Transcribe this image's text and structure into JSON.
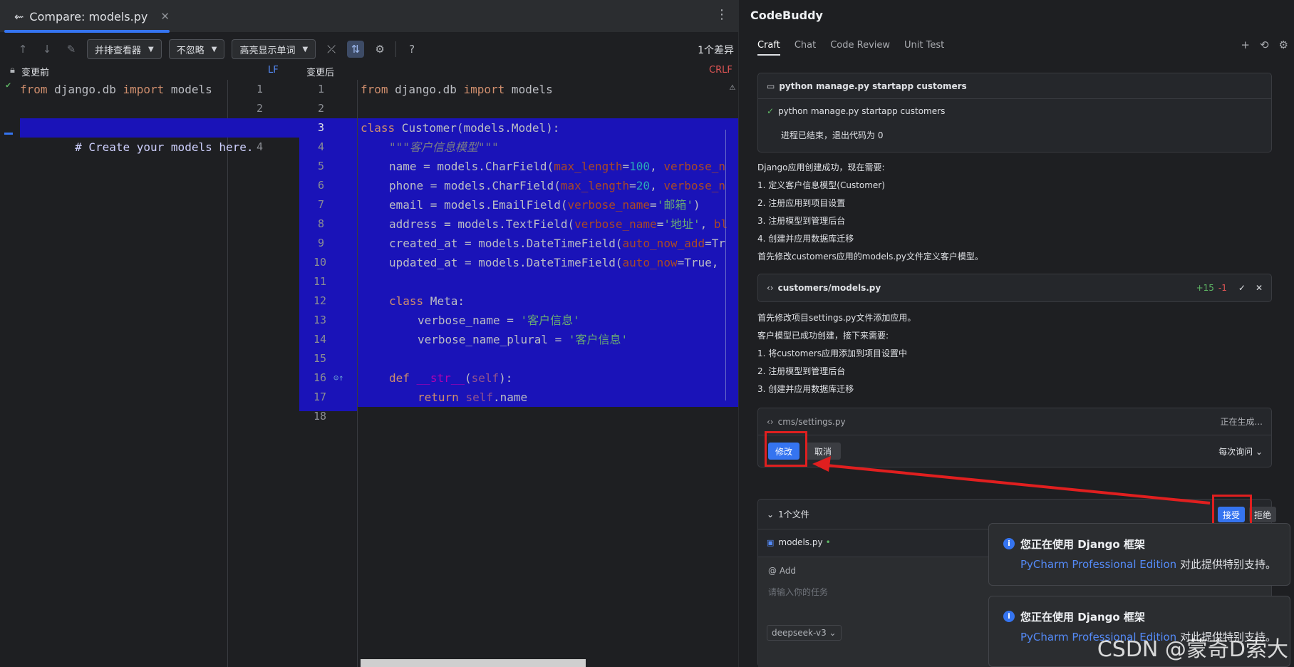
{
  "tab": {
    "title": "Compare: models.py",
    "close": "✕"
  },
  "toolbar": {
    "viewer": "并排查看器",
    "ignore": "不忽略",
    "highlight": "高亮显示单词",
    "help": "?",
    "diff_count": "1个差异"
  },
  "headers": {
    "before": "变更前",
    "before_le": "LF",
    "after": "变更后",
    "after_le": "CRLF"
  },
  "old_lines": [
    "from django.db import models",
    "",
    "# Create your models here.",
    ""
  ],
  "codebuddy": {
    "title": "CodeBuddy",
    "tabs": [
      "Craft",
      "Chat",
      "Code Review",
      "Unit Test"
    ],
    "cmd_card": {
      "title": "python manage.py startapp customers",
      "done": "python manage.py startapp customers",
      "exit": "进程已结束，退出代码为 0"
    },
    "msg1": [
      "Django应用创建成功，现在需要:",
      "1. 定义客户信息模型(Customer)",
      "2. 注册应用到项目设置",
      "3. 注册模型到管理后台",
      "4. 创建并应用数据库迁移",
      "首先修改customers应用的models.py文件定义客户模型。"
    ],
    "file_card": {
      "name": "customers/models.py",
      "added": "+15",
      "removed": "-1"
    },
    "msg2": [
      "首先修改项目settings.py文件添加应用。",
      "客户模型已成功创建，接下来需要:",
      "1. 将customers应用添加到项目设置中",
      "2. 注册模型到管理后台",
      "3. 创建并应用数据库迁移"
    ],
    "settings_card": {
      "name": "cms/settings.py",
      "status": "正在生成...",
      "modify": "修改",
      "cancel": "取消",
      "ask": "每次询问"
    },
    "files_panel": {
      "count": "1个文件",
      "accept": "接受",
      "reject": "拒绝",
      "file": "models.py"
    },
    "input": {
      "add": "@ Add",
      "placeholder": "请输入你的任务",
      "model": "deepseek-v3"
    }
  },
  "notifications": [
    {
      "title": "您正在使用 Django 框架",
      "link": "PyCharm Professional Edition",
      "text": "对此提供特别支持。"
    },
    {
      "title": "您正在使用 Django 框架",
      "link": "PyCharm Professional Edition",
      "text": "对此提供特别支持。"
    }
  ],
  "watermark": "CSDN @蒙奇D索大",
  "colors": {
    "selection": "#1a13b8",
    "accent": "#3574f0",
    "annotation_red": "#e01f1f"
  }
}
